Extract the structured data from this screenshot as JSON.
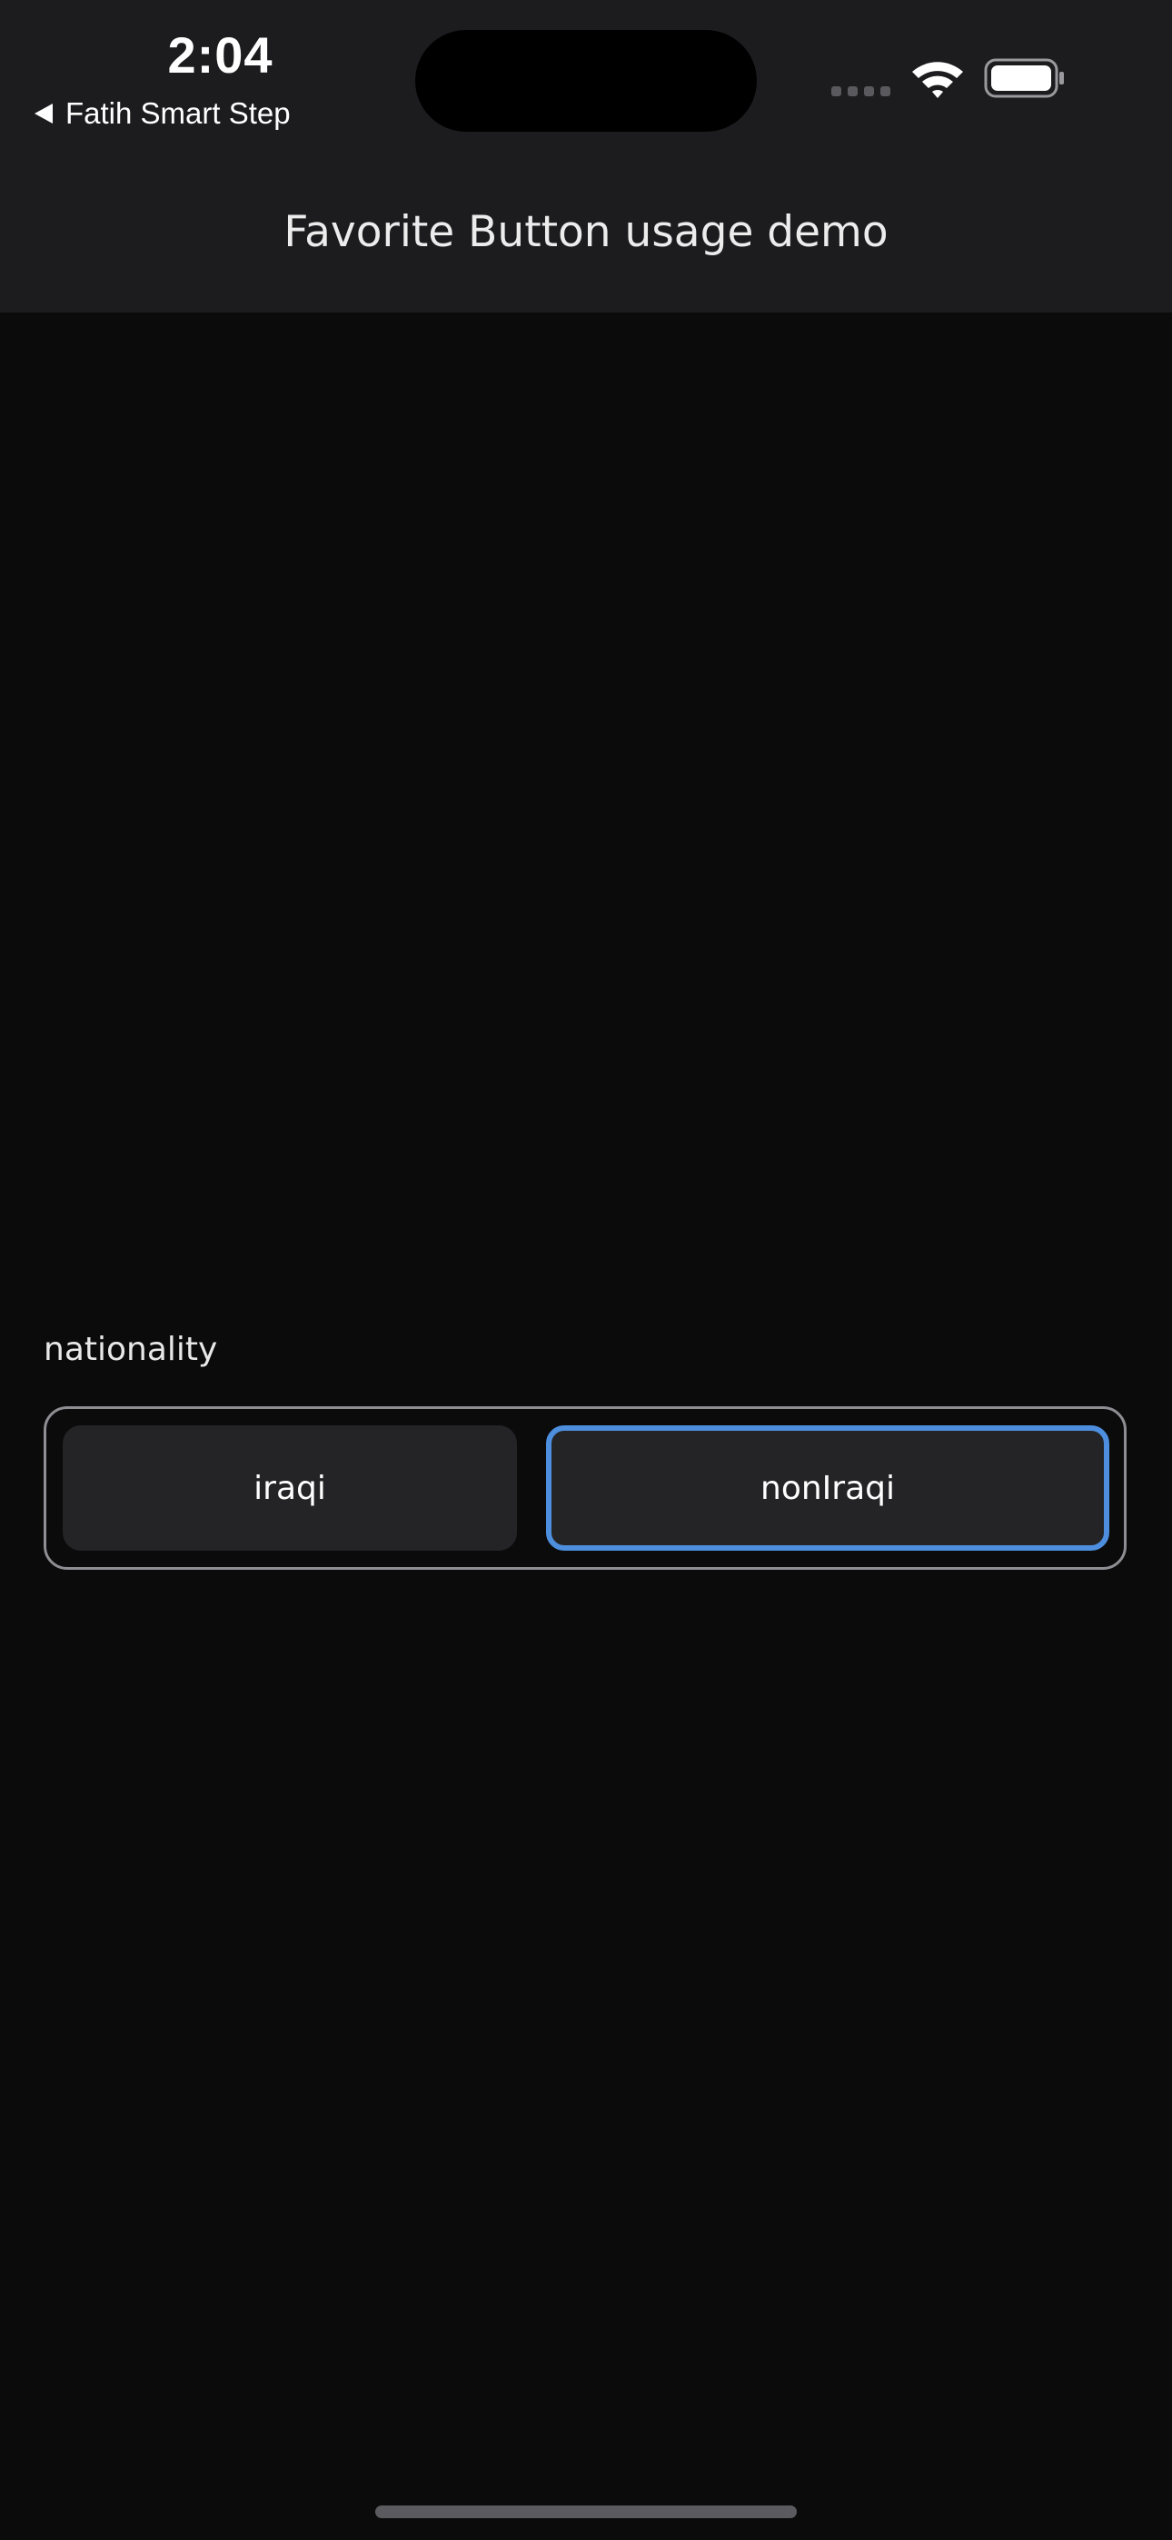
{
  "status_bar": {
    "time": "2:04",
    "back_label": "Fatih Smart Step",
    "wifi_icon": "wifi-icon",
    "battery_icon": "battery-icon",
    "signal_icon": "cellular-signal-icon"
  },
  "nav": {
    "title": "Favorite Button usage demo"
  },
  "form": {
    "field_label": "nationality",
    "options": [
      {
        "label": "iraqi",
        "selected": false
      },
      {
        "label": "nonIraqi",
        "selected": true
      }
    ]
  },
  "colors": {
    "background": "#0b0b0c",
    "topbar": "#1c1c1e",
    "button_fill": "#242426",
    "selected_border": "#4d8fde",
    "group_border": "#8e8e93"
  }
}
